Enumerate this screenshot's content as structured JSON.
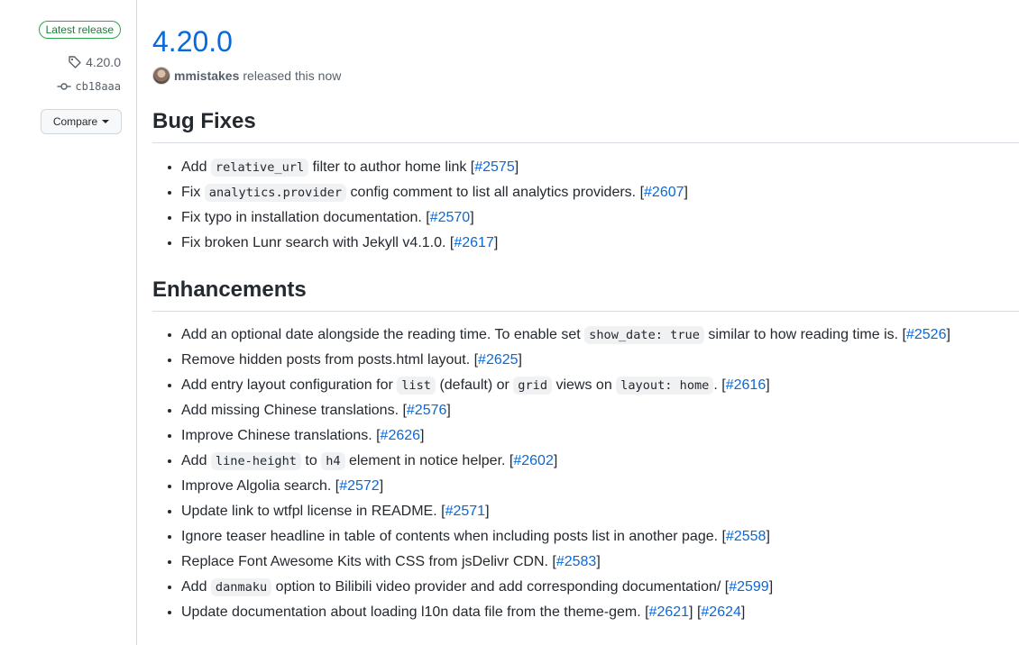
{
  "sidebar": {
    "badge": "Latest release",
    "tag": "4.20.0",
    "commit": "cb18aaa",
    "compare_label": "Compare"
  },
  "release": {
    "version": "4.20.0",
    "author": "mmistakes",
    "released_text": "released this now"
  },
  "sections": {
    "bug_fixes": {
      "heading": "Bug Fixes",
      "items": [
        {
          "parts": [
            {
              "t": "text",
              "v": "Add "
            },
            {
              "t": "code",
              "v": "relative_url"
            },
            {
              "t": "text",
              "v": " filter to author home link ["
            },
            {
              "t": "link",
              "v": "#2575"
            },
            {
              "t": "text",
              "v": "]"
            }
          ]
        },
        {
          "parts": [
            {
              "t": "text",
              "v": "Fix "
            },
            {
              "t": "code",
              "v": "analytics.provider"
            },
            {
              "t": "text",
              "v": " config comment to list all analytics providers. ["
            },
            {
              "t": "link",
              "v": "#2607"
            },
            {
              "t": "text",
              "v": "]"
            }
          ]
        },
        {
          "parts": [
            {
              "t": "text",
              "v": "Fix typo in installation documentation. ["
            },
            {
              "t": "link",
              "v": "#2570"
            },
            {
              "t": "text",
              "v": "]"
            }
          ]
        },
        {
          "parts": [
            {
              "t": "text",
              "v": "Fix broken Lunr search with Jekyll v4.1.0. ["
            },
            {
              "t": "link",
              "v": "#2617"
            },
            {
              "t": "text",
              "v": "]"
            }
          ]
        }
      ]
    },
    "enhancements": {
      "heading": "Enhancements",
      "items": [
        {
          "parts": [
            {
              "t": "text",
              "v": "Add an optional date alongside the reading time. To enable set "
            },
            {
              "t": "code",
              "v": "show_date: true"
            },
            {
              "t": "text",
              "v": " similar to how reading time is. ["
            },
            {
              "t": "link",
              "v": "#2526"
            },
            {
              "t": "text",
              "v": "]"
            }
          ]
        },
        {
          "parts": [
            {
              "t": "text",
              "v": "Remove hidden posts from posts.html layout. ["
            },
            {
              "t": "link",
              "v": "#2625"
            },
            {
              "t": "text",
              "v": "]"
            }
          ]
        },
        {
          "parts": [
            {
              "t": "text",
              "v": "Add entry layout configuration for "
            },
            {
              "t": "code",
              "v": "list"
            },
            {
              "t": "text",
              "v": " (default) or "
            },
            {
              "t": "code",
              "v": "grid"
            },
            {
              "t": "text",
              "v": " views on "
            },
            {
              "t": "code",
              "v": "layout: home"
            },
            {
              "t": "text",
              "v": ". ["
            },
            {
              "t": "link",
              "v": "#2616"
            },
            {
              "t": "text",
              "v": "]"
            }
          ]
        },
        {
          "parts": [
            {
              "t": "text",
              "v": "Add missing Chinese translations. ["
            },
            {
              "t": "link",
              "v": "#2576"
            },
            {
              "t": "text",
              "v": "]"
            }
          ]
        },
        {
          "parts": [
            {
              "t": "text",
              "v": "Improve Chinese translations. ["
            },
            {
              "t": "link",
              "v": "#2626"
            },
            {
              "t": "text",
              "v": "]"
            }
          ]
        },
        {
          "parts": [
            {
              "t": "text",
              "v": "Add "
            },
            {
              "t": "code",
              "v": "line-height"
            },
            {
              "t": "text",
              "v": " to "
            },
            {
              "t": "code",
              "v": "h4"
            },
            {
              "t": "text",
              "v": " element in notice helper. ["
            },
            {
              "t": "link",
              "v": "#2602"
            },
            {
              "t": "text",
              "v": "]"
            }
          ]
        },
        {
          "parts": [
            {
              "t": "text",
              "v": "Improve Algolia search. ["
            },
            {
              "t": "link",
              "v": "#2572"
            },
            {
              "t": "text",
              "v": "]"
            }
          ]
        },
        {
          "parts": [
            {
              "t": "text",
              "v": "Update link to wtfpl license in README. ["
            },
            {
              "t": "link",
              "v": "#2571"
            },
            {
              "t": "text",
              "v": "]"
            }
          ]
        },
        {
          "parts": [
            {
              "t": "text",
              "v": "Ignore teaser headline in table of contents when including posts list in another page. ["
            },
            {
              "t": "link",
              "v": "#2558"
            },
            {
              "t": "text",
              "v": "]"
            }
          ]
        },
        {
          "parts": [
            {
              "t": "text",
              "v": "Replace Font Awesome Kits with CSS from jsDelivr CDN. ["
            },
            {
              "t": "link",
              "v": "#2583"
            },
            {
              "t": "text",
              "v": "]"
            }
          ]
        },
        {
          "parts": [
            {
              "t": "text",
              "v": "Add "
            },
            {
              "t": "code",
              "v": "danmaku"
            },
            {
              "t": "text",
              "v": " option to Bilibili video provider and add corresponding documentation/ ["
            },
            {
              "t": "link",
              "v": "#2599"
            },
            {
              "t": "text",
              "v": "]"
            }
          ]
        },
        {
          "parts": [
            {
              "t": "text",
              "v": "Update documentation about loading l10n data file from the theme-gem. ["
            },
            {
              "t": "link",
              "v": "#2621"
            },
            {
              "t": "text",
              "v": "] ["
            },
            {
              "t": "link",
              "v": "#2624"
            },
            {
              "t": "text",
              "v": "]"
            }
          ]
        }
      ]
    }
  }
}
